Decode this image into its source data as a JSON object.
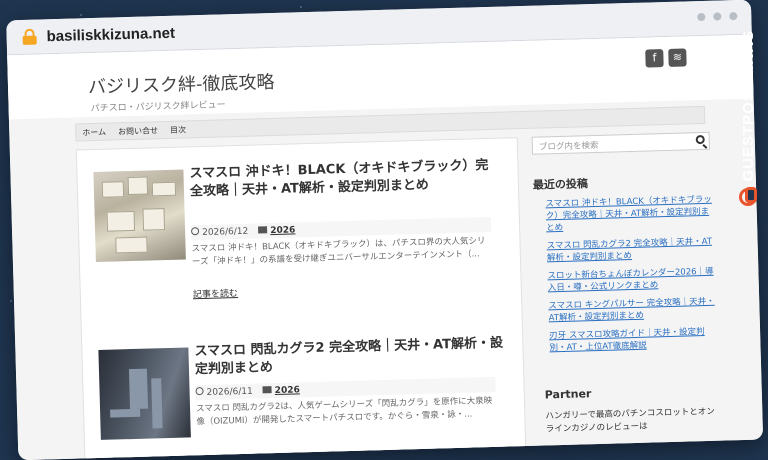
{
  "browser": {
    "url": "basiliskkizuna.net"
  },
  "site": {
    "title": "バジリスク絆-徹底攻略",
    "description": "パチスロ・パジリスク絆レビュー"
  },
  "nav": {
    "items": [
      "ホーム",
      "お問い合せ",
      "目次"
    ]
  },
  "posts": [
    {
      "title": "スマスロ 沖ドキ！BLACK（オキドキブラック）完全攻略｜天井・AT解析・設定判別まとめ",
      "date": "2026/6/12",
      "category": "2026",
      "excerpt": "スマスロ 沖ドキ！BLACK（オキドキブラック）は、パチスロ界の大人気シリーズ「沖ドキ！」の系譜を受け継ぎユニバーサルエンターテインメント（...",
      "more": "記事を読む"
    },
    {
      "title": "スマスロ 閃乱カグラ2 完全攻略｜天井・AT解析・設定判別まとめ",
      "date": "2026/6/11",
      "category": "2026",
      "excerpt": "スマスロ 閃乱カグラ2は、人気ゲームシリーズ「閃乱カグラ」を原作に大泉映像（OIZUMI）が開発したスマートパチスロです。かぐら・雪泉・詠・..."
    }
  ],
  "sidebar": {
    "search_placeholder": "ブログ内を検索",
    "recent_title": "最近の投稿",
    "recent_posts": [
      "スマスロ 沖ドキ！BLACK（オキドキブラック）完全攻略｜天井・AT解析・設定判別まとめ",
      "スマスロ 閃乱カグラ2 完全攻略｜天井・AT解析・設定判別まとめ",
      "スロット新台ちょんぼカレンダー2026｜導入日・噂・公式リンクまとめ",
      "スマスロ キングパルサー 完全攻略｜天井・AT解析・設定判別まとめ",
      "刃牙 スマスロ攻略ガイド｜天井・設定判別・AT・上位AT徹底解説"
    ],
    "partner_title": "Partner",
    "partner_text": "ハンガリーで最高のパチンコスロットとオンラインカジノのレビューは"
  },
  "watermark": {
    "text": "GUESTPOSTLINKS"
  },
  "colors": {
    "background": "#1f3550",
    "link": "#2a6fc1",
    "lock": "#f5a623",
    "watermark_logo": "#e8542b"
  }
}
